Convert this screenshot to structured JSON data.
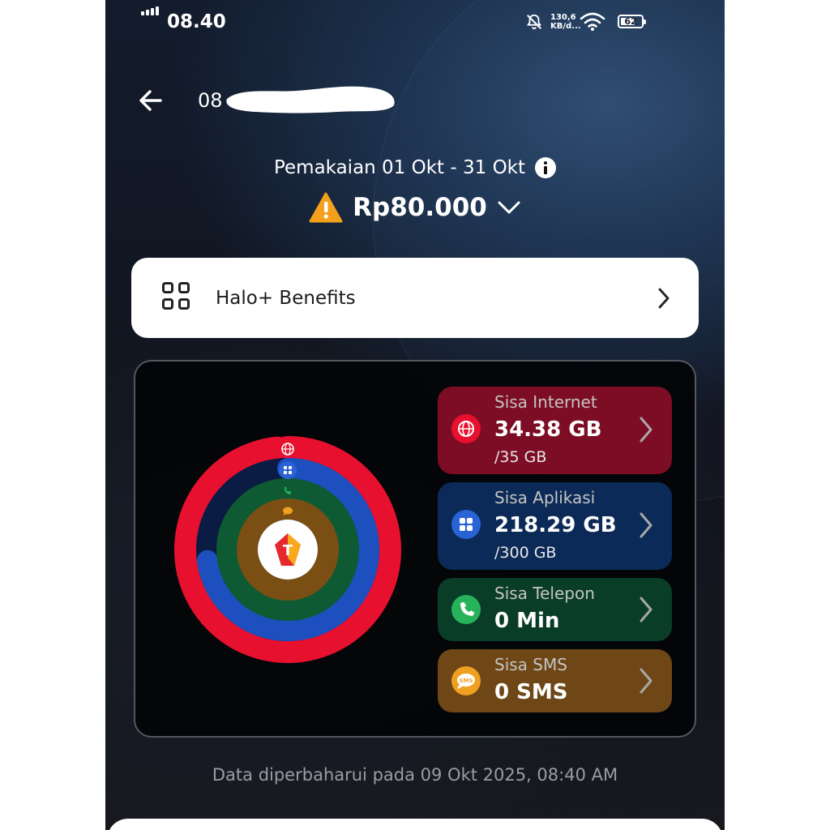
{
  "status_bar": {
    "time": "08.40",
    "network_speed_value": "130,6",
    "network_speed_unit": "KB/d...",
    "battery_level": "62",
    "icons": [
      "signal-icon",
      "bell-off-icon",
      "wifi-icon",
      "battery-icon"
    ]
  },
  "header": {
    "phone_number_visible": "08",
    "back_icon": "arrow-left-icon"
  },
  "usage_summary": {
    "period_label": "Pemakaian 01 Okt - 31 Okt",
    "amount": "Rp80.000",
    "warning_icon": "warning-triangle-icon",
    "expand_icon": "chevron-down-icon"
  },
  "benefits": {
    "label": "Halo+ Benefits",
    "icon": "apps-grid-icon"
  },
  "quotas": [
    {
      "key": "internet",
      "title": "Sisa Internet",
      "value": "34.38 GB",
      "total": "/35 GB",
      "remaining": 34.38,
      "max": 35,
      "color": "#e8102f",
      "card_color": "#7d0d24",
      "icon": "globe-icon"
    },
    {
      "key": "aplikasi",
      "title": "Sisa Aplikasi",
      "value": "218.29 GB",
      "total": "/300 GB",
      "remaining": 218.29,
      "max": 300,
      "color": "#1d4fbf",
      "card_color": "#0c2a57",
      "icon": "apps-icon"
    },
    {
      "key": "telepon",
      "title": "Sisa Telepon",
      "value": "0 Min",
      "remaining": 0,
      "max": 1,
      "color": "#0d5a33",
      "card_color": "#0a3d28",
      "icon": "phone-icon"
    },
    {
      "key": "sms",
      "title": "Sisa SMS",
      "value": "0 SMS",
      "remaining": 0,
      "max": 1,
      "color": "#7b4f14",
      "card_color": "#6f4717",
      "icon": "sms-bubble-icon"
    }
  ],
  "ring_center_icon": "telkomsel-logo-icon",
  "updated_text": "Data diperbaharui pada 09 Okt 2025, 08:40 AM"
}
